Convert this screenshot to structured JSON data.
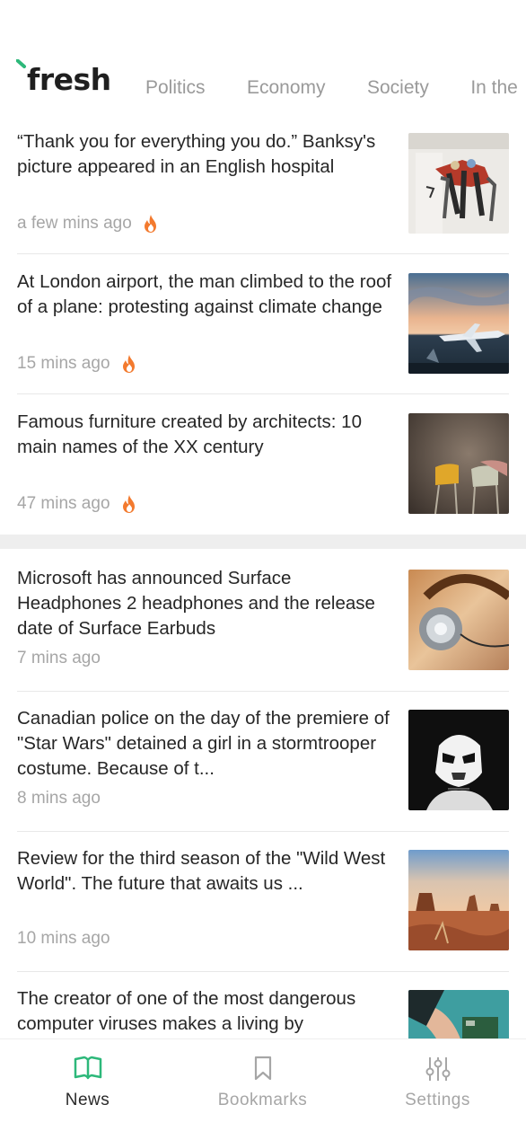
{
  "app": {
    "logo_text": "fresh",
    "accent": "#2db87a"
  },
  "tabs": [
    "Politics",
    "Economy",
    "Society",
    "In the"
  ],
  "articles": [
    {
      "title": "“Thank you for everything you do.” Banksy's picture appeared in an English hospital",
      "time": "a few mins ago",
      "hot": true
    },
    {
      "title": "At London airport, the man climbed to the roof of a plane: protesting against climate change",
      "time": "15 mins ago",
      "hot": true
    },
    {
      "title": "Famous furniture created by architects: 10 main names of the XX century",
      "time": "47 mins ago",
      "hot": true
    },
    {
      "title": "Microsoft has announced Surface Headphones 2 headphones and the release date of Surface Earbuds",
      "time": "7 mins ago",
      "hot": false
    },
    {
      "title": "Canadian police on the day of the premiere of \"Star Wars\" detained a girl in a stormtrooper costume. Because of t...",
      "time": "8 mins ago",
      "hot": false
    },
    {
      "title": "Review for the third season of the \"Wild West World\". The future that awaits us ...",
      "time": "10 mins ago",
      "hot": false
    },
    {
      "title": "The creator of one of the most dangerous computer viruses makes a living by",
      "time": "",
      "hot": false
    }
  ],
  "bottom_nav": [
    {
      "label": "News",
      "icon": "book-open-icon",
      "active": true
    },
    {
      "label": "Bookmarks",
      "icon": "bookmark-icon",
      "active": false
    },
    {
      "label": "Settings",
      "icon": "sliders-icon",
      "active": false
    }
  ],
  "colors": {
    "hot": "#f37a2e",
    "active_nav": "#2db87a",
    "inactive_nav": "#a6a6a6"
  }
}
